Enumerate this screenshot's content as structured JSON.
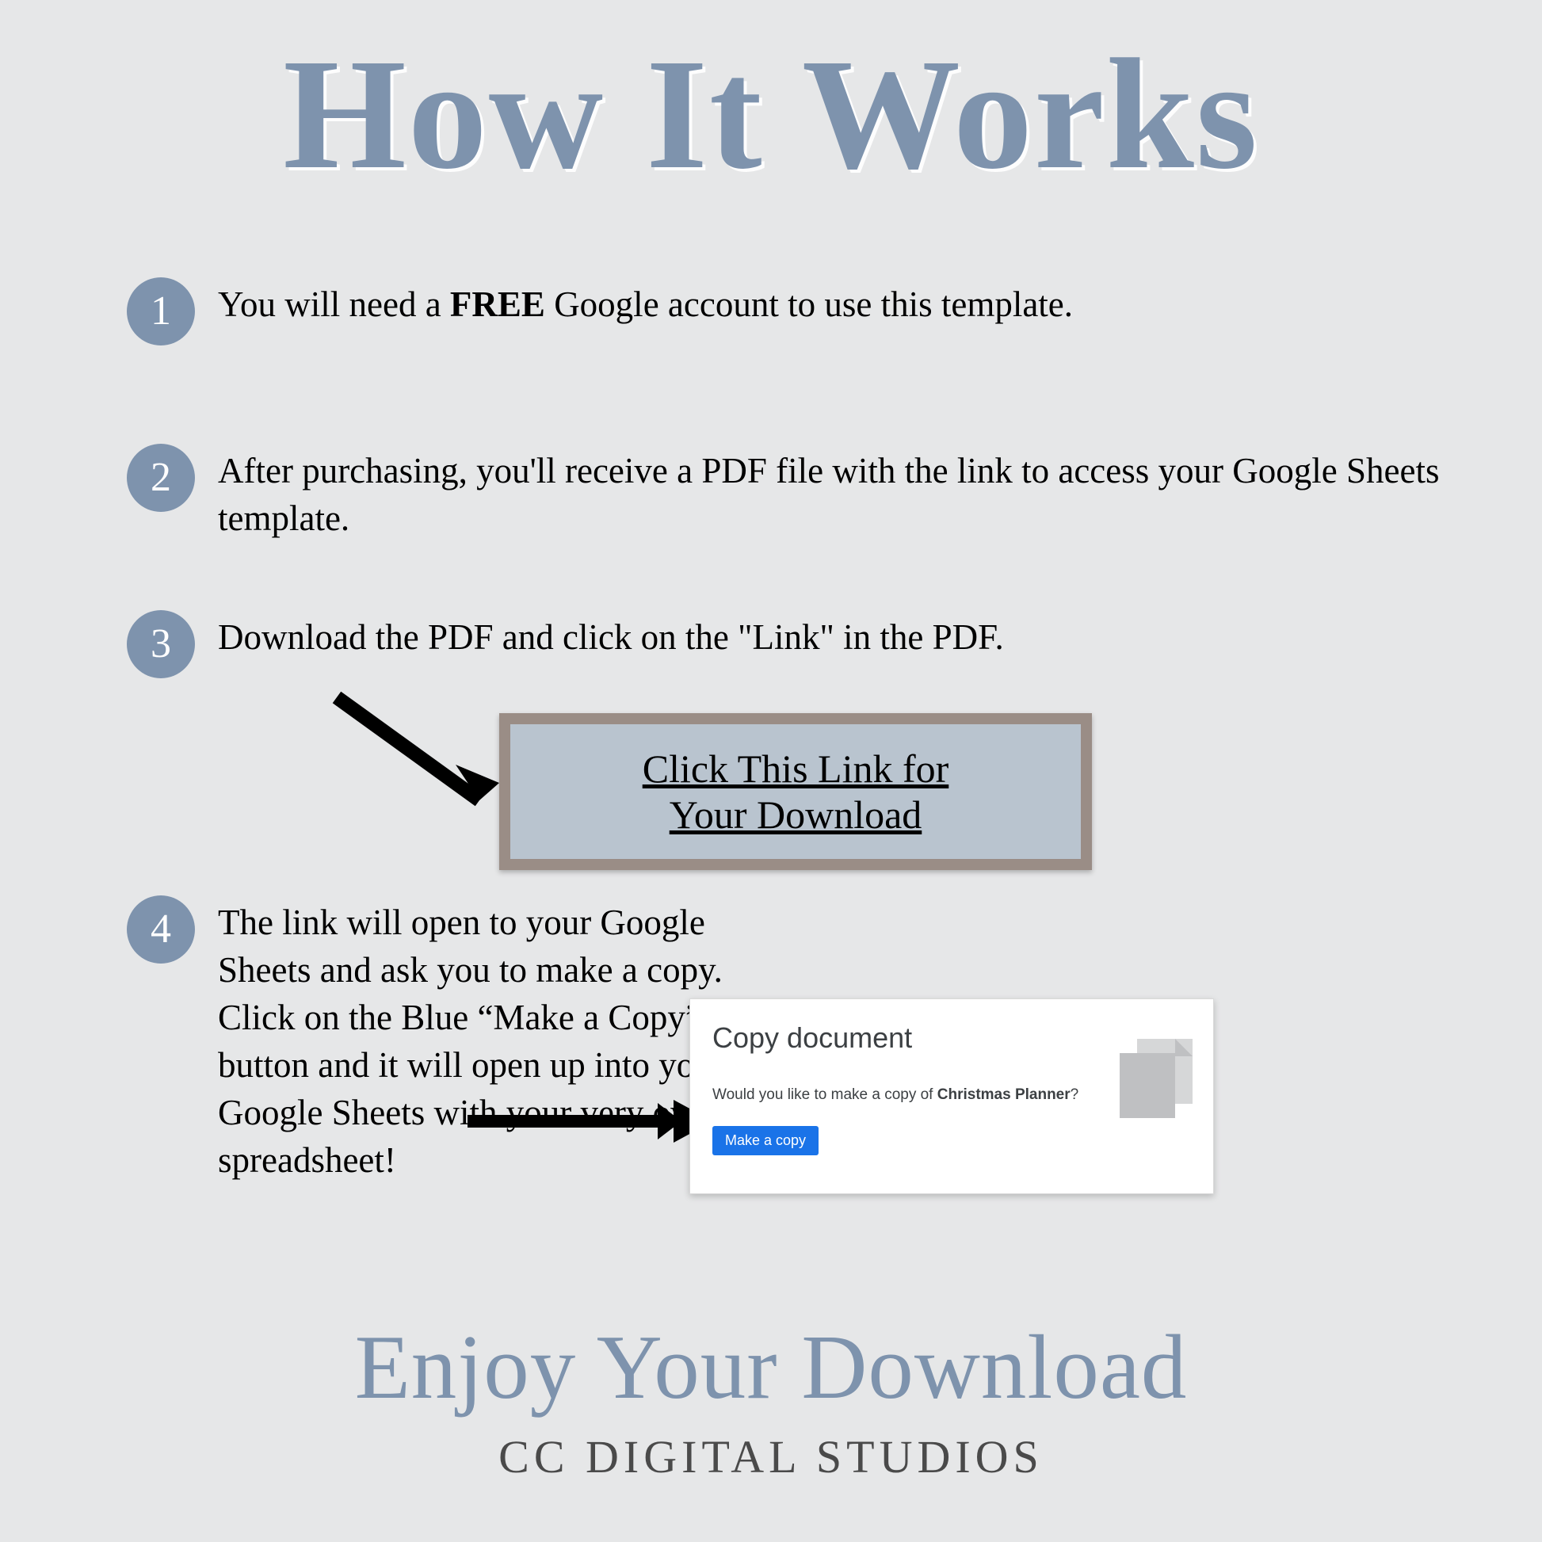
{
  "title": "How It Works",
  "steps": {
    "n1": "1",
    "n2": "2",
    "n3": "3",
    "n4": "4",
    "t1_a": "You will need a ",
    "t1_b": "FREE",
    "t1_c": " Google account to use this template.",
    "t2": "After purchasing, you'll receive a PDF file with the link to access your Google Sheets template.",
    "t3": "Download the PDF and click on the \"Link\" in the PDF.",
    "t4": "The link will open to your Google Sheets and ask you to make a copy.  Click on the Blue “Make a Copy” button and it will open up into your Google Sheets with your very own spreadsheet!"
  },
  "linkcard": {
    "text": "Click This Link for\nYour Download"
  },
  "copycard": {
    "heading": "Copy document",
    "q_a": "Would you like to make a copy of ",
    "q_b": "Christmas Planner",
    "q_c": "?",
    "button": "Make a copy"
  },
  "footer": {
    "enjoy": "Enjoy Your Download",
    "brand": "CC DIGITAL STUDIOS"
  },
  "colors": {
    "accent": "#7e93ad",
    "bg": "#e6e7e8",
    "frame": "#9a8d86",
    "linkbox": "#b9c4cf",
    "blue": "#1a73e8"
  }
}
